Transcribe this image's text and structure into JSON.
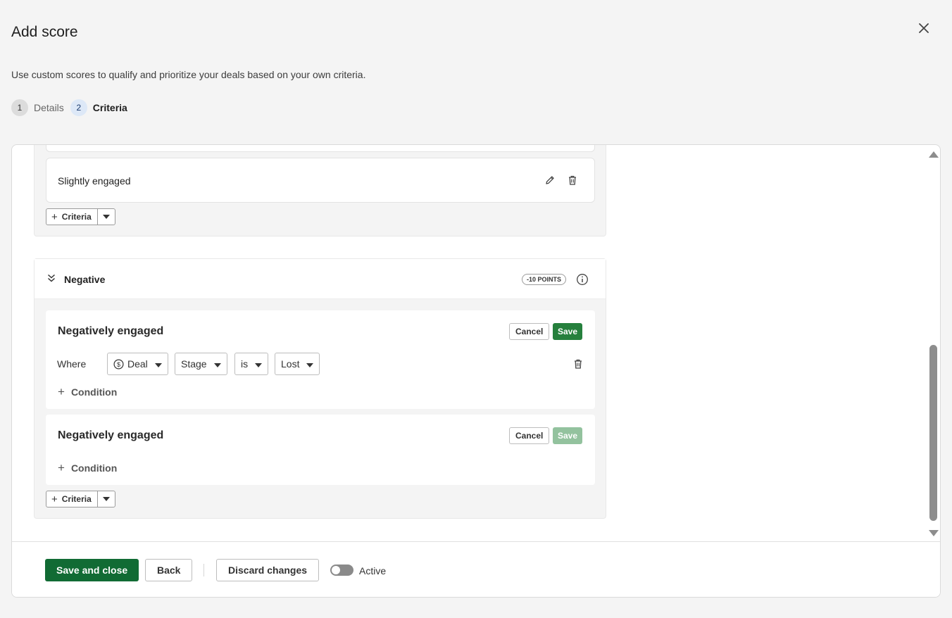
{
  "header": {
    "title": "Add score",
    "subtitle": "Use custom scores to qualify and prioritize your deals based on your own criteria.",
    "close_icon": "close-icon"
  },
  "steps": [
    {
      "number": "1",
      "label": "Details",
      "state": "done"
    },
    {
      "number": "2",
      "label": "Criteria",
      "state": "active"
    }
  ],
  "top_group": {
    "criteria_label": "Slightly engaged",
    "add_criteria_label": "Criteria"
  },
  "negative_group": {
    "name": "Negative",
    "points": "-10 POINTS",
    "cards": [
      {
        "title": "Negatively engaged",
        "cancel": "Cancel",
        "save": "Save",
        "save_enabled": true,
        "where_label": "Where",
        "condition": {
          "entity": "Deal",
          "field": "Stage",
          "operator": "is",
          "value": "Lost"
        },
        "add_condition": "Condition"
      },
      {
        "title": "Negatively engaged",
        "cancel": "Cancel",
        "save": "Save",
        "save_enabled": false,
        "add_condition": "Condition"
      }
    ],
    "add_criteria_label": "Criteria"
  },
  "footer": {
    "save_and_close": "Save and close",
    "back": "Back",
    "discard": "Discard changes",
    "active_label": "Active",
    "active_on": false
  },
  "colors": {
    "primary_green": "#116b34",
    "save_green": "#26803d",
    "save_disabled": "#93c29e"
  }
}
